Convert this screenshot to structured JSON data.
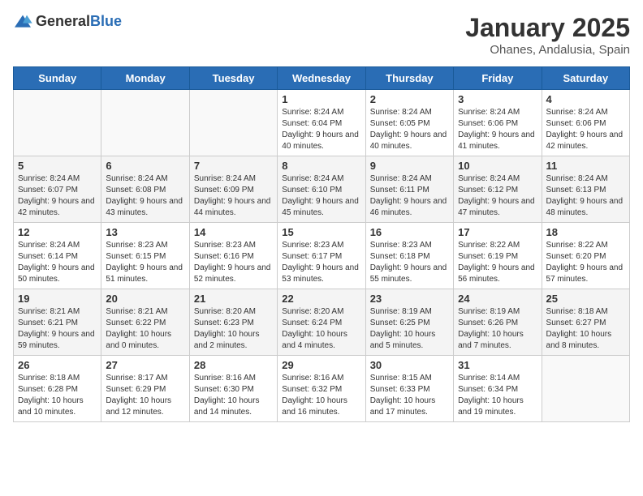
{
  "logo": {
    "general": "General",
    "blue": "Blue"
  },
  "header": {
    "month": "January 2025",
    "location": "Ohanes, Andalusia, Spain"
  },
  "weekdays": [
    "Sunday",
    "Monday",
    "Tuesday",
    "Wednesday",
    "Thursday",
    "Friday",
    "Saturday"
  ],
  "weeks": [
    [
      {
        "day": null
      },
      {
        "day": null
      },
      {
        "day": null
      },
      {
        "day": "1",
        "sunrise": "8:24 AM",
        "sunset": "6:04 PM",
        "daylight": "9 hours and 40 minutes."
      },
      {
        "day": "2",
        "sunrise": "8:24 AM",
        "sunset": "6:05 PM",
        "daylight": "9 hours and 40 minutes."
      },
      {
        "day": "3",
        "sunrise": "8:24 AM",
        "sunset": "6:06 PM",
        "daylight": "9 hours and 41 minutes."
      },
      {
        "day": "4",
        "sunrise": "8:24 AM",
        "sunset": "6:06 PM",
        "daylight": "9 hours and 42 minutes."
      }
    ],
    [
      {
        "day": "5",
        "sunrise": "8:24 AM",
        "sunset": "6:07 PM",
        "daylight": "9 hours and 42 minutes."
      },
      {
        "day": "6",
        "sunrise": "8:24 AM",
        "sunset": "6:08 PM",
        "daylight": "9 hours and 43 minutes."
      },
      {
        "day": "7",
        "sunrise": "8:24 AM",
        "sunset": "6:09 PM",
        "daylight": "9 hours and 44 minutes."
      },
      {
        "day": "8",
        "sunrise": "8:24 AM",
        "sunset": "6:10 PM",
        "daylight": "9 hours and 45 minutes."
      },
      {
        "day": "9",
        "sunrise": "8:24 AM",
        "sunset": "6:11 PM",
        "daylight": "9 hours and 46 minutes."
      },
      {
        "day": "10",
        "sunrise": "8:24 AM",
        "sunset": "6:12 PM",
        "daylight": "9 hours and 47 minutes."
      },
      {
        "day": "11",
        "sunrise": "8:24 AM",
        "sunset": "6:13 PM",
        "daylight": "9 hours and 48 minutes."
      }
    ],
    [
      {
        "day": "12",
        "sunrise": "8:24 AM",
        "sunset": "6:14 PM",
        "daylight": "9 hours and 50 minutes."
      },
      {
        "day": "13",
        "sunrise": "8:23 AM",
        "sunset": "6:15 PM",
        "daylight": "9 hours and 51 minutes."
      },
      {
        "day": "14",
        "sunrise": "8:23 AM",
        "sunset": "6:16 PM",
        "daylight": "9 hours and 52 minutes."
      },
      {
        "day": "15",
        "sunrise": "8:23 AM",
        "sunset": "6:17 PM",
        "daylight": "9 hours and 53 minutes."
      },
      {
        "day": "16",
        "sunrise": "8:23 AM",
        "sunset": "6:18 PM",
        "daylight": "9 hours and 55 minutes."
      },
      {
        "day": "17",
        "sunrise": "8:22 AM",
        "sunset": "6:19 PM",
        "daylight": "9 hours and 56 minutes."
      },
      {
        "day": "18",
        "sunrise": "8:22 AM",
        "sunset": "6:20 PM",
        "daylight": "9 hours and 57 minutes."
      }
    ],
    [
      {
        "day": "19",
        "sunrise": "8:21 AM",
        "sunset": "6:21 PM",
        "daylight": "9 hours and 59 minutes."
      },
      {
        "day": "20",
        "sunrise": "8:21 AM",
        "sunset": "6:22 PM",
        "daylight": "10 hours and 0 minutes."
      },
      {
        "day": "21",
        "sunrise": "8:20 AM",
        "sunset": "6:23 PM",
        "daylight": "10 hours and 2 minutes."
      },
      {
        "day": "22",
        "sunrise": "8:20 AM",
        "sunset": "6:24 PM",
        "daylight": "10 hours and 4 minutes."
      },
      {
        "day": "23",
        "sunrise": "8:19 AM",
        "sunset": "6:25 PM",
        "daylight": "10 hours and 5 minutes."
      },
      {
        "day": "24",
        "sunrise": "8:19 AM",
        "sunset": "6:26 PM",
        "daylight": "10 hours and 7 minutes."
      },
      {
        "day": "25",
        "sunrise": "8:18 AM",
        "sunset": "6:27 PM",
        "daylight": "10 hours and 8 minutes."
      }
    ],
    [
      {
        "day": "26",
        "sunrise": "8:18 AM",
        "sunset": "6:28 PM",
        "daylight": "10 hours and 10 minutes."
      },
      {
        "day": "27",
        "sunrise": "8:17 AM",
        "sunset": "6:29 PM",
        "daylight": "10 hours and 12 minutes."
      },
      {
        "day": "28",
        "sunrise": "8:16 AM",
        "sunset": "6:30 PM",
        "daylight": "10 hours and 14 minutes."
      },
      {
        "day": "29",
        "sunrise": "8:16 AM",
        "sunset": "6:32 PM",
        "daylight": "10 hours and 16 minutes."
      },
      {
        "day": "30",
        "sunrise": "8:15 AM",
        "sunset": "6:33 PM",
        "daylight": "10 hours and 17 minutes."
      },
      {
        "day": "31",
        "sunrise": "8:14 AM",
        "sunset": "6:34 PM",
        "daylight": "10 hours and 19 minutes."
      },
      {
        "day": null
      }
    ]
  ]
}
